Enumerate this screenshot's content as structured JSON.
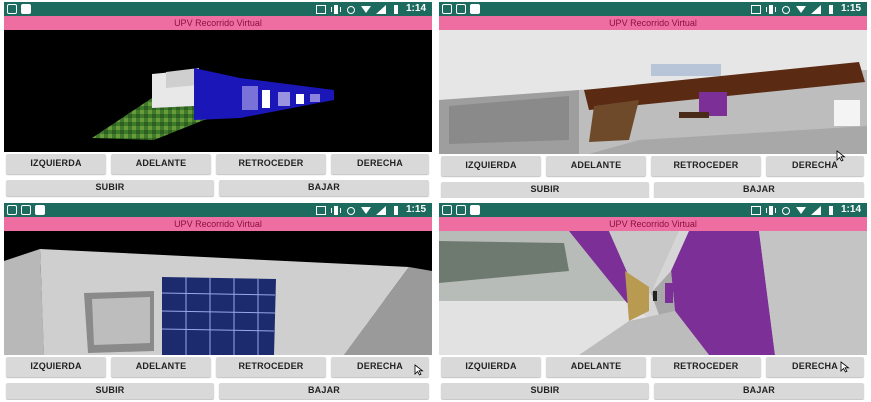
{
  "app": {
    "title": "UPV Recorrido Virtual"
  },
  "colors": {
    "statusbar": "#1d6b5f",
    "titlebar": "#ee6ea2",
    "button": "#d9d9d9",
    "building_blue": "#1a16b8",
    "wall_purple": "#7d2f98",
    "beam_brown": "#5a2a12"
  },
  "buttons": {
    "left": "IZQUIERDA",
    "forward": "ADELANTE",
    "back": "RETROCEDER",
    "right": "DERECHA",
    "up": "SUBIR",
    "down": "BAJAR"
  },
  "screens": [
    {
      "time": "1:14",
      "scene": "building-exterior-blue"
    },
    {
      "time": "1:15",
      "scene": "indoor-ceiling-beam"
    },
    {
      "time": "1:15",
      "scene": "building-exterior-grey"
    },
    {
      "time": "1:14",
      "scene": "corridor-purple"
    }
  ]
}
